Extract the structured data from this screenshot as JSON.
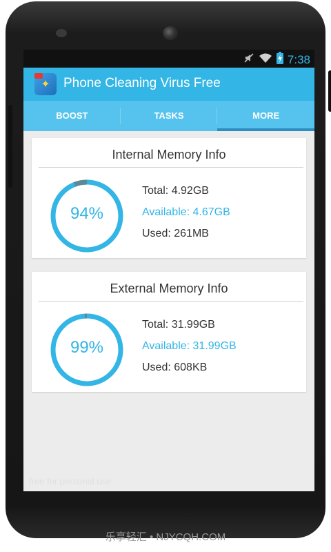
{
  "status_bar": {
    "time": "7:38",
    "icons": [
      "mute-icon",
      "wifi-icon",
      "battery-charging-icon"
    ],
    "accent": "#33b5e5"
  },
  "app_bar": {
    "title": "Phone Cleaning Virus Free",
    "color": "#33b5e5"
  },
  "tabs": [
    {
      "label": "BOOST",
      "active": false
    },
    {
      "label": "TASKS",
      "active": false
    },
    {
      "label": "MORE",
      "active": true
    }
  ],
  "internal": {
    "title": "Internal Memory Info",
    "percent": 94,
    "percent_label": "94%",
    "total": "Total: 4.92GB",
    "available": "Available: 4.67GB",
    "used": "Used: 261MB"
  },
  "external": {
    "title": "External Memory Info",
    "percent": 99,
    "percent_label": "99%",
    "total": "Total: 31.99GB",
    "available": "Available: 31.99GB",
    "used": "Used: 608KB"
  },
  "inner_watermark": "free for personal use",
  "watermark": "乐享轻汇 • NJYCQH.COM"
}
